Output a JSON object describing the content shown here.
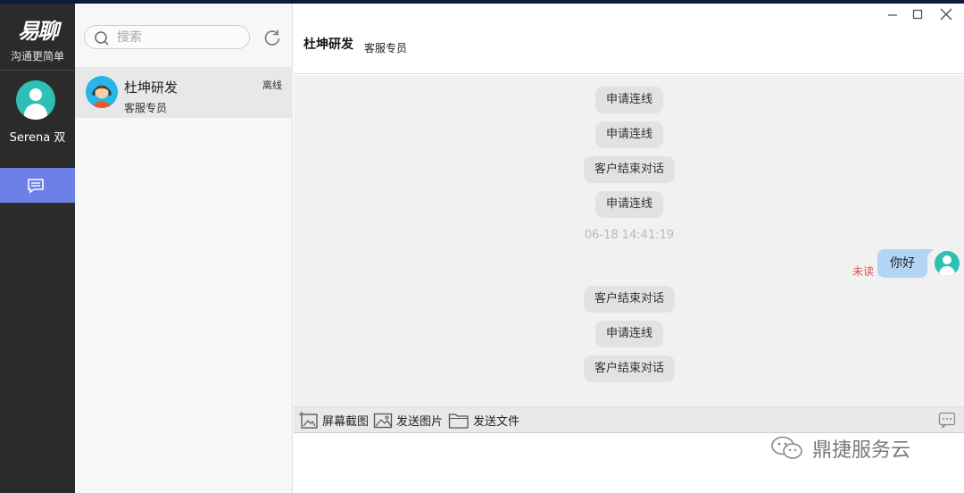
{
  "app": {
    "logo_text": "易聊",
    "tagline": "沟通更简单"
  },
  "user": {
    "name": "Serena 双"
  },
  "search": {
    "placeholder": "搜索"
  },
  "contacts": [
    {
      "name": "杜坤研发",
      "subtitle": "客服专员",
      "status": "离线"
    }
  ],
  "chat": {
    "title": "杜坤研发",
    "subtitle": "客服专员",
    "messages": [
      {
        "type": "system",
        "text": "申请连线"
      },
      {
        "type": "system",
        "text": "申请连线"
      },
      {
        "type": "system",
        "text": "客户结束对话"
      },
      {
        "type": "system",
        "text": "申请连线"
      },
      {
        "type": "timestamp",
        "text": "06-18 14:41:19"
      },
      {
        "type": "outgoing",
        "text": "你好",
        "status": "未读"
      },
      {
        "type": "system",
        "text": "客户结束对话"
      },
      {
        "type": "system",
        "text": "申请连线"
      },
      {
        "type": "system",
        "text": "客户结束对话"
      }
    ]
  },
  "toolbar": {
    "screenshot_label": "屏幕截图",
    "send_image_label": "发送图片",
    "send_file_label": "发送文件"
  },
  "composer": {
    "value": ""
  },
  "watermark": {
    "text": "鼎捷服务云"
  },
  "colors": {
    "nav_bg": "#2b2b2b",
    "nav_active": "#6d80e8",
    "avatar_teal": "#2ec0b4",
    "outgoing_bubble": "#b3d4f5",
    "system_pill": "#e2e2e2",
    "unread_red": "#e05050"
  },
  "icons": [
    "chat-list-icon",
    "search-icon",
    "refresh-icon",
    "minimize-icon",
    "maximize-icon",
    "close-icon",
    "screenshot-icon",
    "image-icon",
    "folder-icon",
    "more-icon",
    "wechat-icon"
  ]
}
